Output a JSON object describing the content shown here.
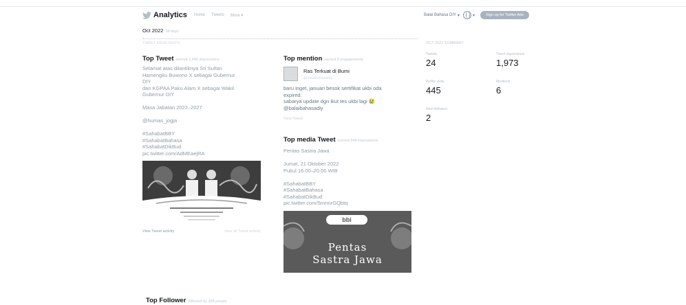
{
  "header": {
    "brand": "Analytics",
    "nav": [
      "Home",
      "Tweets",
      "More"
    ],
    "user_label": "Balai Bahasa DIY",
    "ads_button": "Sign up for Twitter Ads"
  },
  "period": {
    "label": "Oct 2022",
    "sub": "28 days",
    "summary": "TWEET HIGHLIGHTS"
  },
  "top_tweet": {
    "title": "Top Tweet",
    "subtitle": "earned 1,456 impressions",
    "lines": [
      "Selamat atas dilantiknya Sri Sultan",
      "Hamengku Buwono X sebagai Gubernur",
      "DIY",
      "dan KGPAA Paku Alam X sebagai Wakil",
      "Gubernur DIY",
      "",
      "Masa Jabatan 2022–2027",
      "",
      "@humas_jogja",
      "",
      "#SahabatBBY",
      "#SahabatBahasa",
      "#SahabatDikBud",
      "pic.twitter.com/AdMEaejRA"
    ],
    "view_activity": "View Tweet activity",
    "view_all": "View all Tweet activity"
  },
  "top_mention": {
    "title": "Top mention",
    "subtitle": "earned 5 engagements",
    "name": "Ras Terkuat di Bumi",
    "handle": "@balaibahasadiy",
    "lines": [
      "baru inget, januari besok sertifikat ukbi oda",
      "expired.",
      "sabarya update dgn ikut tes ukbi lagi 😢",
      "@balaibahasadiy"
    ],
    "view_tweet": "View Tweet"
  },
  "top_media": {
    "title": "Top media Tweet",
    "subtitle": "earned 548 impressions",
    "lines": [
      "Pentas Sastra Jawa",
      "",
      "Jumat, 21 Oktober 2022",
      "Pukul 16.00–20.00 WIB",
      "",
      "#SahabatBBY",
      "#SahabatBahasa",
      "#SahabatDikBud",
      "pic.twitter.com/5mrmrGQbtq"
    ],
    "poster_logo": "bbi",
    "poster_title_1": "Pentas",
    "poster_title_2": "Sastra Jawa"
  },
  "top_follower": {
    "title": "Top Follower",
    "subtitle": "followed by 328 people"
  },
  "stats": {
    "title": "OCT 2022 SUMMARY",
    "items": [
      {
        "label": "Tweets",
        "value": "24"
      },
      {
        "label": "Tweet impressions",
        "value": "1,973"
      },
      {
        "label": "Profile visits",
        "value": "445"
      },
      {
        "label": "Mentions",
        "value": "6"
      },
      {
        "label": "New followers",
        "value": "2"
      }
    ]
  }
}
